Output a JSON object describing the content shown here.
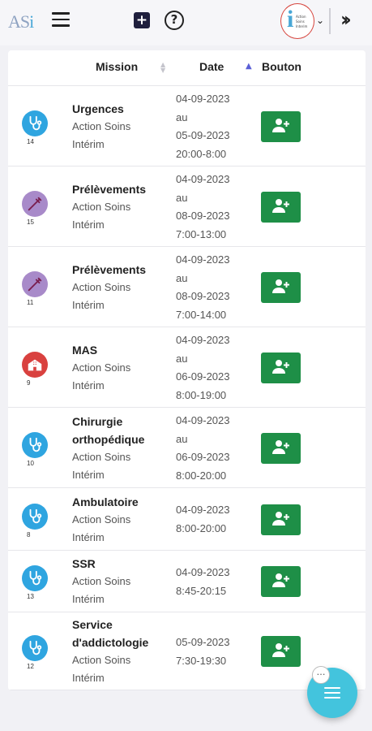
{
  "header": {
    "logo_text_a": "AS",
    "logo_text_i": "i",
    "avatar_caption": [
      "Action",
      "Soins",
      "Interim"
    ]
  },
  "table": {
    "columns": [
      "Mission",
      "Date",
      "Bouton"
    ],
    "rows": [
      {
        "icon": "stethoscope-icon",
        "icon_color": "#2fa5e0",
        "count": "14",
        "title_lines": [
          "Urgences"
        ],
        "company": "Action Soins",
        "type": "Intérim",
        "date_lines": [
          "04-09-2023",
          "au",
          "05-09-2023",
          "20:00-8:00"
        ]
      },
      {
        "icon": "syringe-icon",
        "icon_color": "#a88ac9",
        "count": "15",
        "title_lines": [
          "Prélèvements"
        ],
        "company": "Action Soins",
        "type": "Intérim",
        "date_lines": [
          "04-09-2023",
          "au",
          "08-09-2023",
          "7:00-13:00"
        ]
      },
      {
        "icon": "syringe-icon",
        "icon_color": "#a88ac9",
        "count": "11",
        "title_lines": [
          "Prélèvements"
        ],
        "company": "Action Soins",
        "type": "Intérim",
        "date_lines": [
          "04-09-2023",
          "au",
          "08-09-2023",
          "7:00-14:00"
        ]
      },
      {
        "icon": "hospital-icon",
        "icon_color": "#d9413f",
        "count": "9",
        "title_lines": [
          "MAS"
        ],
        "company": "Action Soins",
        "type": "Intérim",
        "date_lines": [
          "04-09-2023",
          "au",
          "06-09-2023",
          "8:00-19:00"
        ]
      },
      {
        "icon": "stethoscope-icon",
        "icon_color": "#2fa5e0",
        "count": "10",
        "title_lines": [
          "Chirurgie",
          "orthopédique"
        ],
        "company": "Action Soins",
        "type": "Intérim",
        "date_lines": [
          "04-09-2023",
          "au",
          "06-09-2023",
          "8:00-20:00"
        ]
      },
      {
        "icon": "stethoscope-icon",
        "icon_color": "#2fa5e0",
        "count": "8",
        "title_lines": [
          "Ambulatoire"
        ],
        "company": "Action Soins",
        "type": "Intérim",
        "date_lines": [
          "04-09-2023",
          "8:00-20:00"
        ]
      },
      {
        "icon": "stethoscope-icon",
        "icon_color": "#2fa5e0",
        "count": "13",
        "title_lines": [
          "SSR"
        ],
        "company": "Action Soins",
        "type": "Intérim",
        "date_lines": [
          "04-09-2023",
          "8:45-20:15"
        ]
      },
      {
        "icon": "stethoscope-icon",
        "icon_color": "#2fa5e0",
        "count": "12",
        "title_lines": [
          "Service",
          "d'addictologie"
        ],
        "company": "Action Soins",
        "type": "Intérim",
        "date_lines": [
          "05-09-2023",
          "7:30-19:30"
        ]
      }
    ]
  },
  "colors": {
    "accent_button": "#1e8f47",
    "fab": "#43c4dd",
    "sort_active": "#5a5fd6"
  }
}
